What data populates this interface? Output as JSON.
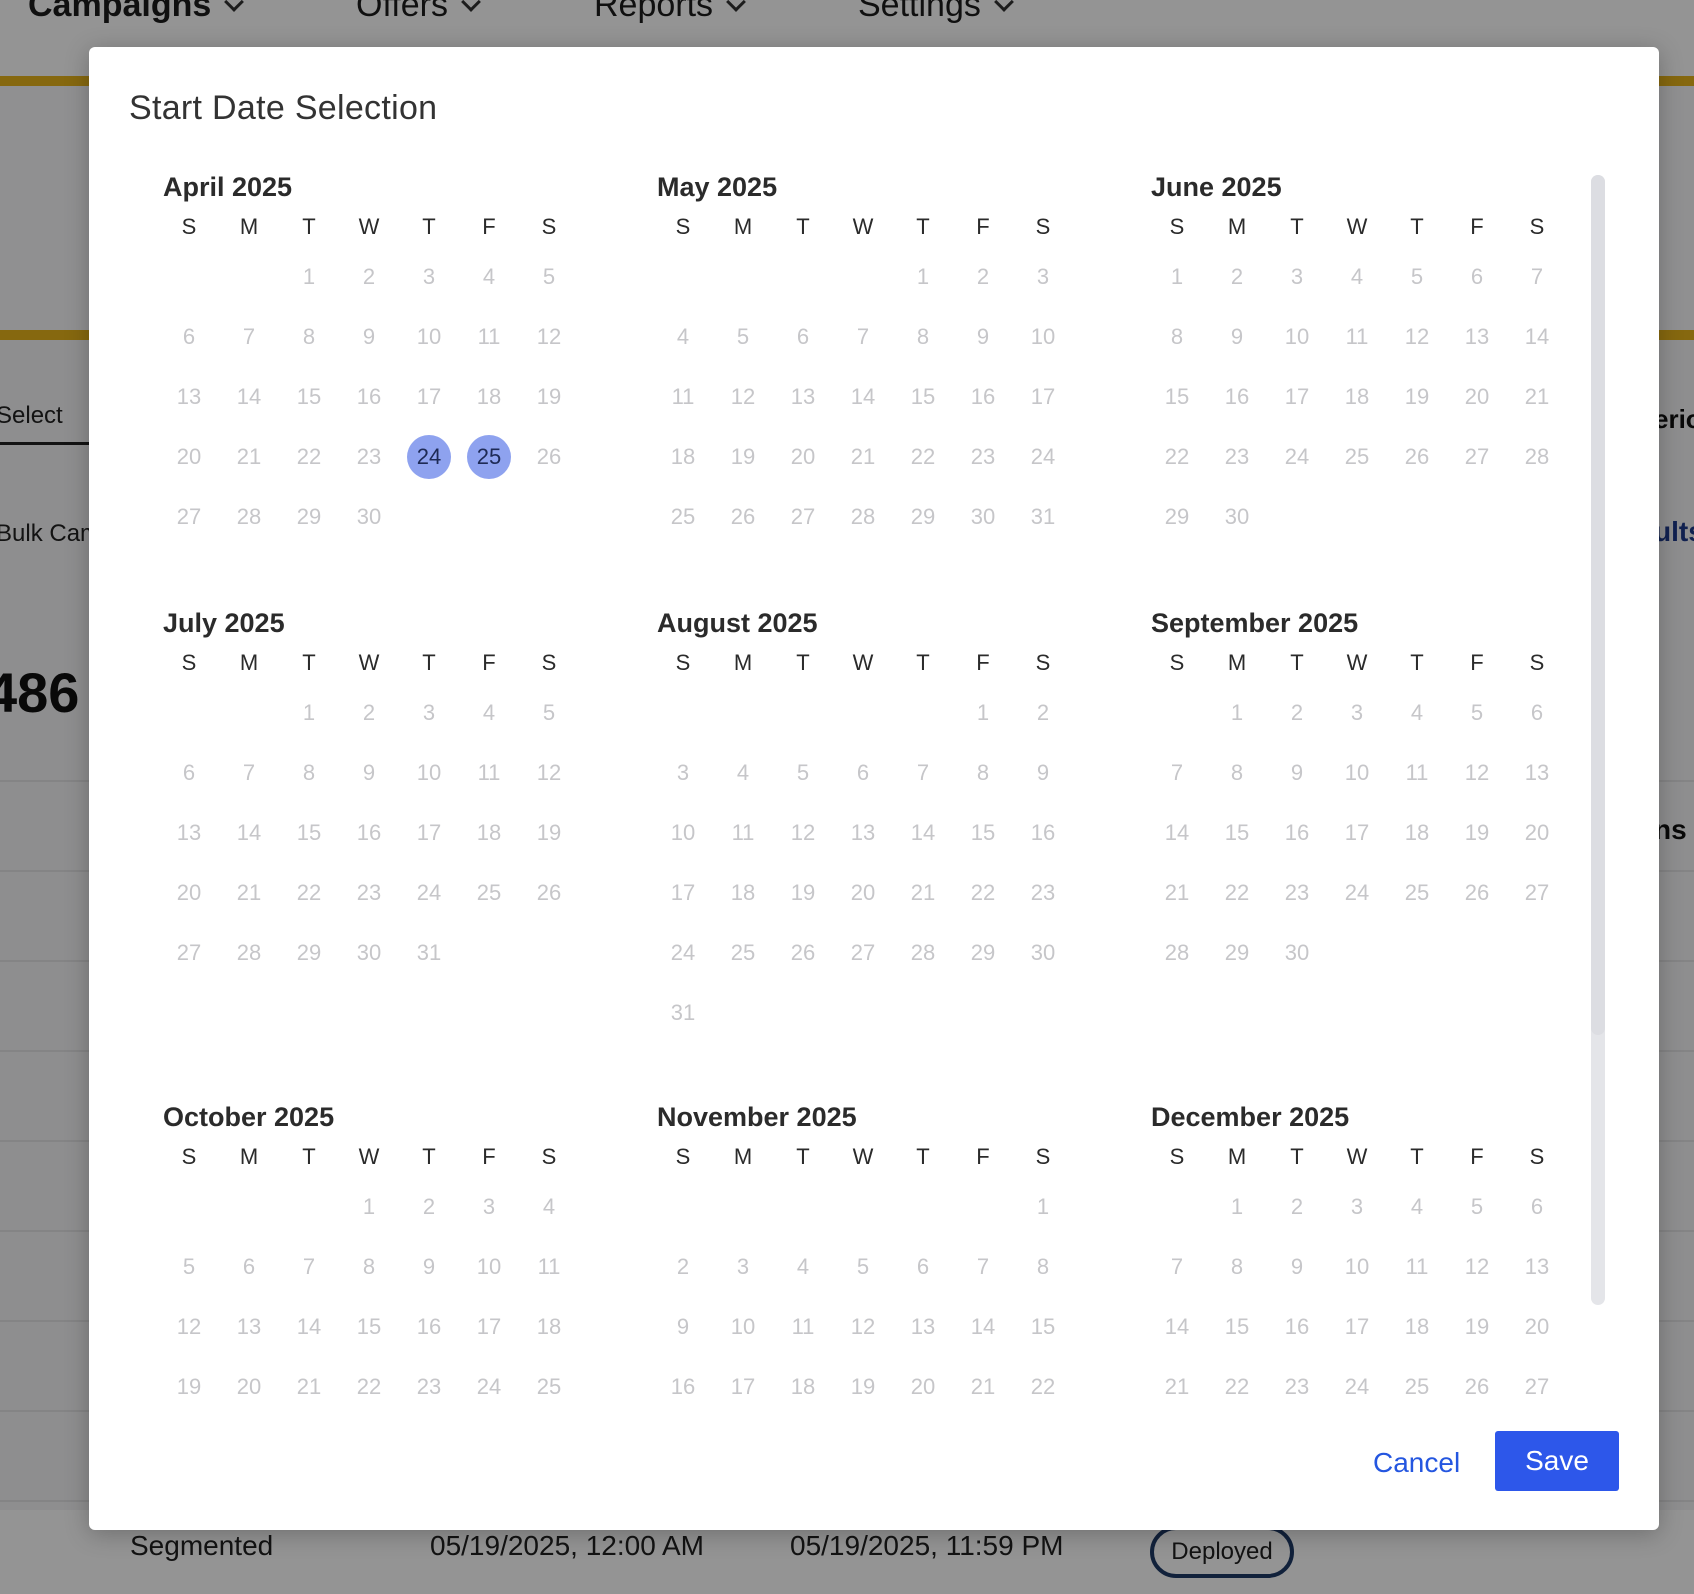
{
  "background": {
    "nav": [
      "Campaigns",
      "Offers",
      "Reports",
      "Settings"
    ],
    "select_label": "Select",
    "bulk_label": "Bulk Cam",
    "big_number": "486",
    "right_partial_1": "erio",
    "right_partial_2": "ults",
    "right_partial_3": "ns",
    "footer_row": {
      "type": "Segmented",
      "start": "05/19/2025, 12:00 AM",
      "end": "05/19/2025, 11:59 PM",
      "status": "Deployed"
    }
  },
  "modal": {
    "title": "Start Date Selection",
    "weekday_headers": [
      "S",
      "M",
      "T",
      "W",
      "T",
      "F",
      "S"
    ],
    "selected_dates": [
      "2025-04-24",
      "2025-04-25"
    ],
    "months": [
      {
        "title": "April 2025",
        "first_weekday": 2,
        "days_shown": 30
      },
      {
        "title": "May 2025",
        "first_weekday": 4,
        "days_shown": 31
      },
      {
        "title": "June 2025",
        "first_weekday": 0,
        "days_shown": 30
      },
      {
        "title": "July 2025",
        "first_weekday": 2,
        "days_shown": 31
      },
      {
        "title": "August 2025",
        "first_weekday": 5,
        "days_shown": 31
      },
      {
        "title": "September 2025",
        "first_weekday": 1,
        "days_shown": 30
      },
      {
        "title": "October 2025",
        "first_weekday": 3,
        "days_shown": 25
      },
      {
        "title": "November 2025",
        "first_weekday": 6,
        "days_shown": 22
      },
      {
        "title": "December 2025",
        "first_weekday": 1,
        "days_shown": 27
      }
    ],
    "cancel_label": "Cancel",
    "save_label": "Save",
    "colors": {
      "selected_bg": "#8ea2ef",
      "primary": "#2d57ea",
      "link": "#2456e0"
    }
  }
}
